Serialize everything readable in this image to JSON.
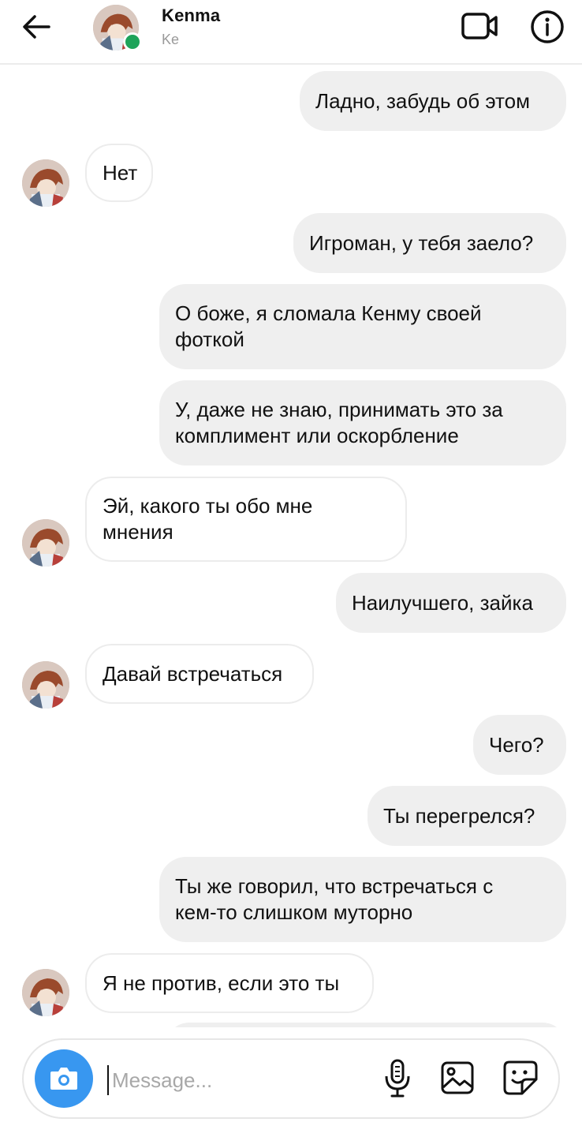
{
  "header": {
    "name": "Kenma",
    "status": "Ke"
  },
  "messages": [
    {
      "side": "out",
      "text": "Ладно, забудь об этом"
    },
    {
      "side": "in",
      "text": "Нет"
    },
    {
      "side": "out",
      "text": "Игроман, у тебя заело?"
    },
    {
      "side": "out",
      "text": "О боже, я сломала Кенму своей фоткой"
    },
    {
      "side": "out",
      "text": "У, даже не знаю, принимать это за комплимент или оскорбление"
    },
    {
      "side": "in",
      "text": "Эй, какого ты обо мне мнения"
    },
    {
      "side": "out",
      "text": "Наилучшего, зайка"
    },
    {
      "side": "in",
      "text": "Давай встречаться"
    },
    {
      "side": "out",
      "text": "Чего?"
    },
    {
      "side": "out",
      "text": "Ты перегрелся?"
    },
    {
      "side": "out",
      "text": "Ты же говорил, что встречаться с кем-то слишком муторно"
    },
    {
      "side": "in",
      "text": "Я не против, если это ты"
    }
  ],
  "composer": {
    "placeholder": "Message..."
  },
  "icons": {
    "back": "arrow-left-icon",
    "video": "video-camera-icon",
    "info": "info-icon",
    "camera": "camera-icon",
    "mic": "microphone-icon",
    "gallery": "image-icon",
    "sticker": "sticker-icon"
  },
  "colors": {
    "online": "#1ea35a",
    "accent": "#3897f0",
    "bubble_out": "#efefef"
  }
}
